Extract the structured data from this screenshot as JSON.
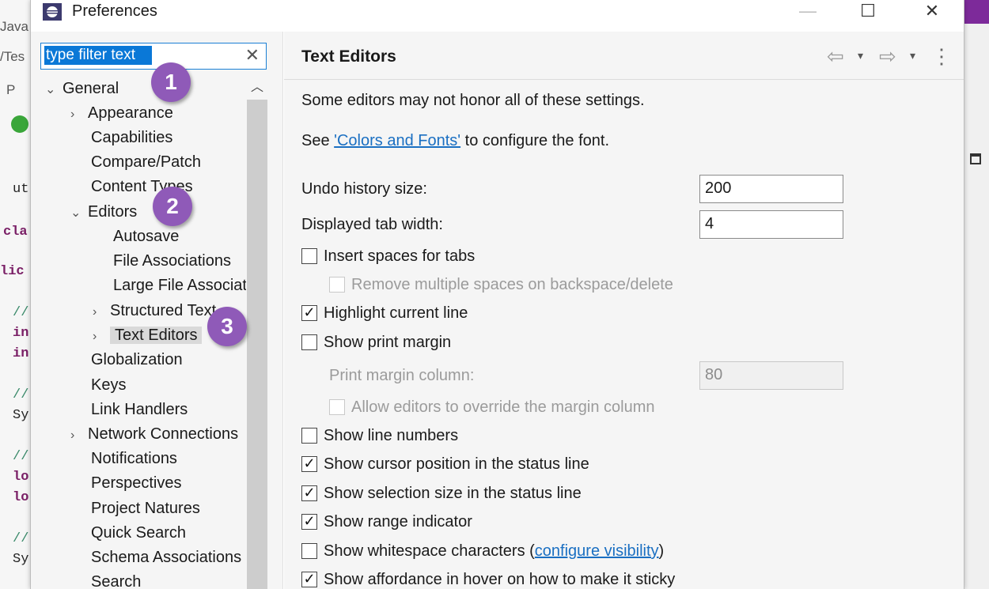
{
  "background": {
    "fragments": [
      "Java",
      "/Tes",
      "P",
      "ut",
      "cla",
      "lic",
      "//",
      "in",
      "in",
      "//",
      "Sy",
      "//",
      "lo",
      "lo",
      "//",
      "Sy"
    ]
  },
  "window": {
    "title": "Preferences",
    "controls": {
      "minimize": "—",
      "maximize": "☐",
      "close": "✕"
    }
  },
  "filter": {
    "value": "type filter text",
    "clear": "✕"
  },
  "tree": {
    "items": [
      {
        "label": "General",
        "twisty": "⌄"
      },
      {
        "label": "Appearance",
        "twisty": "›"
      },
      {
        "label": "Capabilities",
        "twisty": ""
      },
      {
        "label": "Compare/Patch",
        "twisty": ""
      },
      {
        "label": "Content Types",
        "twisty": ""
      },
      {
        "label": "Editors",
        "twisty": "⌄"
      },
      {
        "label": "Autosave",
        "twisty": ""
      },
      {
        "label": "File Associations",
        "twisty": ""
      },
      {
        "label": "Large File Associations",
        "twisty": ""
      },
      {
        "label": "Structured Text",
        "twisty": "›"
      },
      {
        "label": "Text Editors",
        "twisty": "›"
      },
      {
        "label": "Globalization",
        "twisty": ""
      },
      {
        "label": "Keys",
        "twisty": ""
      },
      {
        "label": "Link Handlers",
        "twisty": ""
      },
      {
        "label": "Network Connections",
        "twisty": "›"
      },
      {
        "label": "Notifications",
        "twisty": ""
      },
      {
        "label": "Perspectives",
        "twisty": ""
      },
      {
        "label": "Project Natures",
        "twisty": ""
      },
      {
        "label": "Quick Search",
        "twisty": ""
      },
      {
        "label": "Schema Associations",
        "twisty": ""
      },
      {
        "label": "Search",
        "twisty": ""
      }
    ]
  },
  "page": {
    "title": "Text Editors",
    "nav": {
      "back": "⇦",
      "forward": "⇨",
      "dropdown": "▾",
      "menu": "⋮"
    },
    "intro": "Some editors may not honor all of these settings.",
    "font_line": {
      "before": "See ",
      "link": "'Colors and Fonts'",
      "after": " to configure the font."
    },
    "undo": {
      "label": "Undo history size:",
      "value": "200"
    },
    "tab_width": {
      "label": "Displayed tab width:",
      "value": "4"
    },
    "options": {
      "insert_spaces": {
        "label": "Insert spaces for tabs",
        "checked": false
      },
      "remove_spaces": {
        "label": "Remove multiple spaces on backspace/delete",
        "checked": false
      },
      "highlight_line": {
        "label": "Highlight current line",
        "checked": true
      },
      "print_margin": {
        "label": "Show print margin",
        "checked": false
      },
      "margin_column": {
        "label": "Print margin column:",
        "value": "80"
      },
      "allow_override": {
        "label": "Allow editors to override the margin column",
        "checked": false
      },
      "line_numbers": {
        "label": "Show line numbers",
        "checked": false
      },
      "cursor_position": {
        "label": "Show cursor position in the status line",
        "checked": true
      },
      "selection_size": {
        "label": "Show selection size in the status line",
        "checked": true
      },
      "range_indicator": {
        "label": "Show range indicator",
        "checked": true
      },
      "whitespace": {
        "label": "Show whitespace characters (",
        "link": "configure visibility",
        "after": ")",
        "checked": false
      },
      "affordance": {
        "label": "Show affordance in hover on how to make it sticky",
        "checked": true
      }
    },
    "check_mark": "✓"
  },
  "callouts": [
    "1",
    "2",
    "3"
  ],
  "colors": {
    "accent": "#0a78d7",
    "badge": "#8f5ab8",
    "link": "#1a6fc2"
  }
}
